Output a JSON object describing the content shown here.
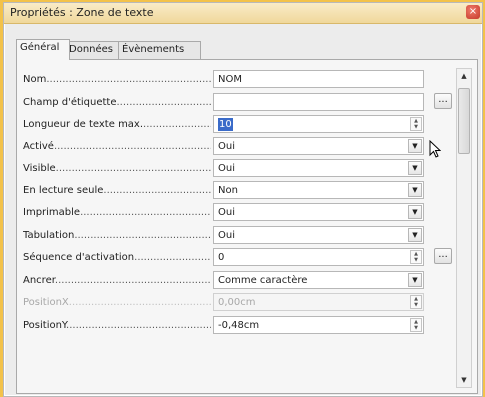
{
  "window": {
    "title": "Propriétés : Zone de texte",
    "close_glyph": "×"
  },
  "tabs": [
    {
      "label": "Général"
    },
    {
      "label": "Données"
    },
    {
      "label": "Évènements"
    }
  ],
  "properties": [
    {
      "label": "Nom",
      "value": "NOM",
      "control": "text",
      "dots": false,
      "disabled": false
    },
    {
      "label": "Champ d'étiquette",
      "value": "",
      "control": "text",
      "dots": true,
      "disabled": false
    },
    {
      "label": "Longueur de texte max.",
      "value": "10",
      "control": "spin",
      "selected": true,
      "dots": false,
      "disabled": false
    },
    {
      "label": "Activé",
      "value": "Oui",
      "control": "dropdown",
      "dots": false,
      "disabled": false
    },
    {
      "label": "Visible",
      "value": "Oui",
      "control": "dropdown",
      "dots": false,
      "disabled": false
    },
    {
      "label": "En lecture seule",
      "value": "Non",
      "control": "dropdown",
      "dots": false,
      "disabled": false
    },
    {
      "label": "Imprimable",
      "value": "Oui",
      "control": "dropdown",
      "dots": false,
      "disabled": false
    },
    {
      "label": "Tabulation",
      "value": "Oui",
      "control": "dropdown",
      "dots": false,
      "disabled": false
    },
    {
      "label": "Séquence d'activation",
      "value": "0",
      "control": "spin",
      "dots": true,
      "disabled": false
    },
    {
      "label": "Ancrer",
      "value": "Comme caractère",
      "control": "dropdown",
      "dots": false,
      "disabled": false
    },
    {
      "label": "PositionX",
      "value": "0,00cm",
      "control": "spin",
      "dots": false,
      "disabled": true
    },
    {
      "label": "PositionY",
      "value": "-0,48cm",
      "control": "spin",
      "dots": false,
      "disabled": false
    }
  ],
  "dots_label": "...",
  "icons": {
    "dropdown": "chevron-down-icon",
    "spin": "spin-arrows-icon",
    "cursor": "mouse-pointer-icon"
  }
}
